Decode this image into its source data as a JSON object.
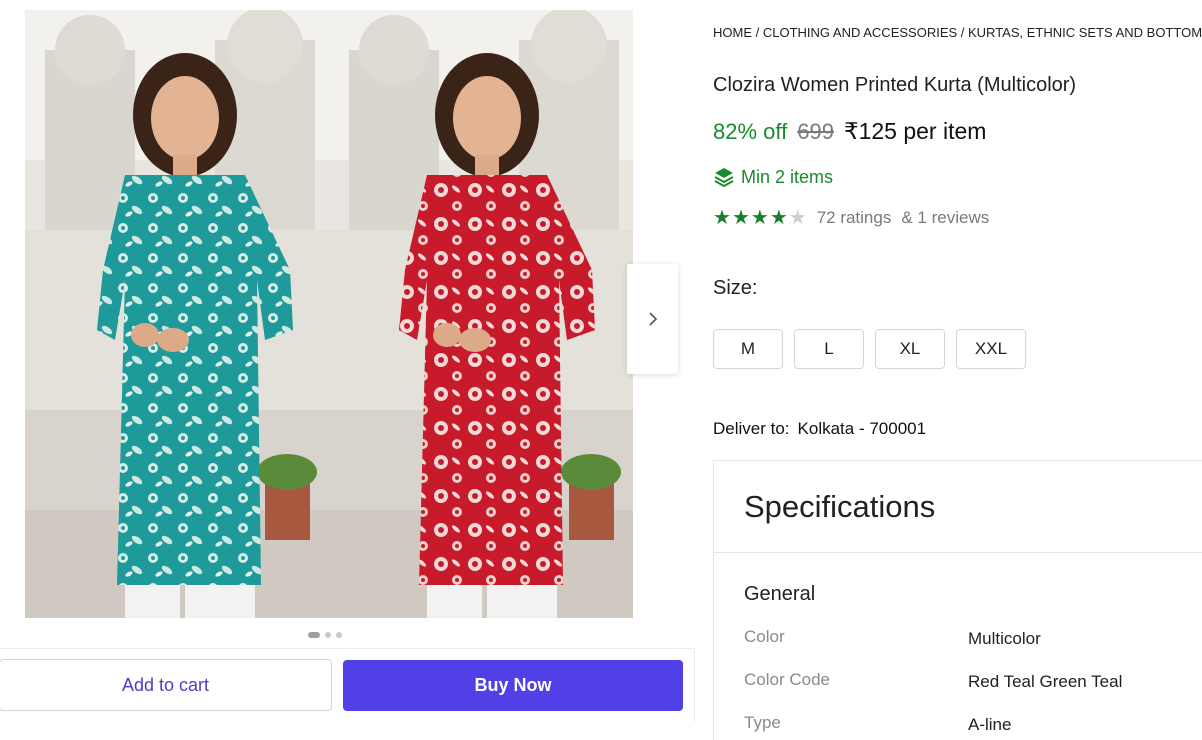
{
  "gallery": {
    "images": [
      {
        "alt": "Teal printed kurta",
        "color": "#1e9a9a"
      },
      {
        "alt": "Red printed kurta",
        "color": "#c71a2a"
      }
    ],
    "next_icon": "chevron-right-icon",
    "page_count": 3,
    "active_index": 0
  },
  "actions": {
    "add_to_cart": "Add to cart",
    "buy_now": "Buy Now"
  },
  "breadcrumb": "HOME / CLOTHING AND ACCESSORIES / KURTAS, ETHNIC SETS AND BOTTOMS /",
  "product": {
    "title": "Clozira Women Printed Kurta (Multicolor)",
    "discount": "82% off",
    "mrp": "699",
    "price": "₹125 per item",
    "min_order": "Min 2 items",
    "rating_value": 4,
    "rating_max": 5,
    "ratings_count": "72 ratings",
    "reviews_count": "& 1 reviews"
  },
  "size": {
    "label": "Size:",
    "options": [
      "M",
      "L",
      "XL",
      "XXL"
    ]
  },
  "delivery": {
    "label": "Deliver to:",
    "location": "Kolkata - 700001"
  },
  "specifications": {
    "title": "Specifications",
    "section": "General",
    "rows": [
      {
        "key": "Color",
        "value": "Multicolor"
      },
      {
        "key": "Color Code",
        "value": "Red Teal Green Teal"
      },
      {
        "key": "Type",
        "value": "A-line"
      }
    ]
  },
  "colors": {
    "accent": "#5040e6",
    "discount_green": "#1b8a2e",
    "star_green": "#1a7f2c"
  }
}
